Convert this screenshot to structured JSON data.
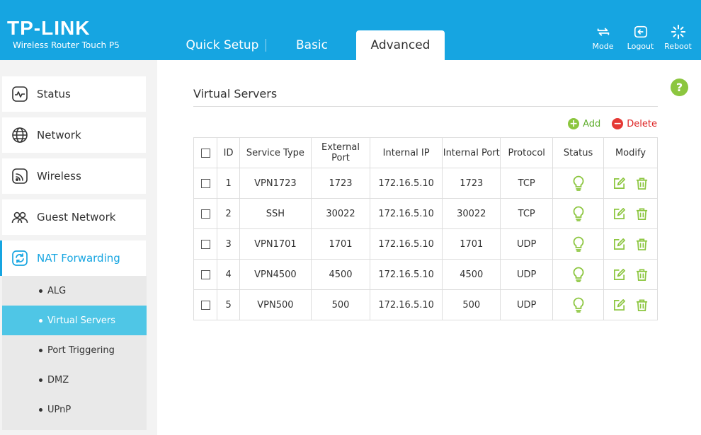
{
  "header": {
    "logo": "TP-LINK",
    "model": "Wireless Router Touch P5",
    "tabs": [
      {
        "label": "Quick Setup"
      },
      {
        "label": "Basic"
      },
      {
        "label": "Advanced"
      }
    ],
    "buttons": [
      {
        "label": "Mode",
        "icon": "mode-icon"
      },
      {
        "label": "Logout",
        "icon": "logout-icon"
      },
      {
        "label": "Reboot",
        "icon": "reboot-icon"
      }
    ]
  },
  "sidebar": {
    "items": [
      {
        "label": "Status",
        "icon": "status-icon"
      },
      {
        "label": "Network",
        "icon": "globe-icon"
      },
      {
        "label": "Wireless",
        "icon": "wireless-icon"
      },
      {
        "label": "Guest Network",
        "icon": "guest-icon"
      },
      {
        "label": "NAT Forwarding",
        "icon": "nat-icon"
      }
    ],
    "subitems": [
      {
        "label": "ALG"
      },
      {
        "label": "Virtual Servers"
      },
      {
        "label": "Port Triggering"
      },
      {
        "label": "DMZ"
      },
      {
        "label": "UPnP"
      }
    ]
  },
  "main": {
    "title": "Virtual Servers",
    "help_label": "?",
    "add_label": "Add",
    "delete_label": "Delete",
    "columns": [
      "ID",
      "Service Type",
      "External Port",
      "Internal IP",
      "Internal Port",
      "Protocol",
      "Status",
      "Modify"
    ],
    "rows": [
      {
        "id": "1",
        "service": "VPN1723",
        "ext_port": "1723",
        "ip": "172.16.5.10",
        "int_port": "1723",
        "protocol": "TCP"
      },
      {
        "id": "2",
        "service": "SSH",
        "ext_port": "30022",
        "ip": "172.16.5.10",
        "int_port": "30022",
        "protocol": "TCP"
      },
      {
        "id": "3",
        "service": "VPN1701",
        "ext_port": "1701",
        "ip": "172.16.5.10",
        "int_port": "1701",
        "protocol": "UDP"
      },
      {
        "id": "4",
        "service": "VPN4500",
        "ext_port": "4500",
        "ip": "172.16.5.10",
        "int_port": "4500",
        "protocol": "UDP"
      },
      {
        "id": "5",
        "service": "VPN500",
        "ext_port": "500",
        "ip": "172.16.5.10",
        "int_port": "500",
        "protocol": "UDP"
      }
    ]
  },
  "colors": {
    "brand": "#16a5e1",
    "active_sub": "#4fc6e6",
    "green": "#8cc63f",
    "red": "#e53935"
  }
}
